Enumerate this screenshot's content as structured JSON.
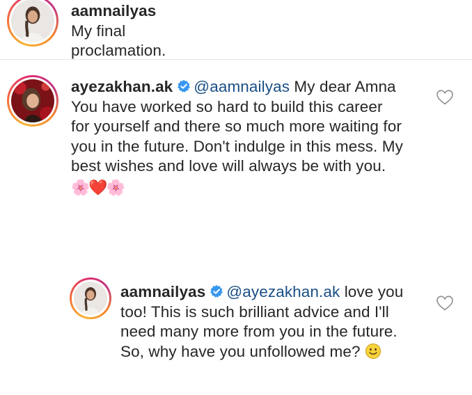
{
  "comments": [
    {
      "username": "aamnailyas",
      "text": "My final proclamation."
    },
    {
      "username": "ayezakhan.ak",
      "mention": "@aamnailyas",
      "line1_rest": "My dear Amna",
      "line2": "You have worked so hard to build this career",
      "line3": "for yourself and there so much more waiting for",
      "line4": "you in the future. Don't indulge in this mess. My",
      "line5": "best wishes and love will always be with you.",
      "emojis": "🌸❤️🌸"
    }
  ],
  "reply": {
    "username": "aamnailyas",
    "mention": "@ayezakhan.ak",
    "line1_rest": "love you",
    "line2": "too! This is such brilliant advice and I'll",
    "line3": "need many more from you in the future.",
    "line4": "So, why have you unfollowed me?",
    "emoji": "🙂"
  },
  "icons": {
    "verified": "verified-badge-icon",
    "like": "heart-outline-icon"
  },
  "colors": {
    "mention": "#1a4f85",
    "verified": "#3897f0",
    "text": "#262626"
  }
}
